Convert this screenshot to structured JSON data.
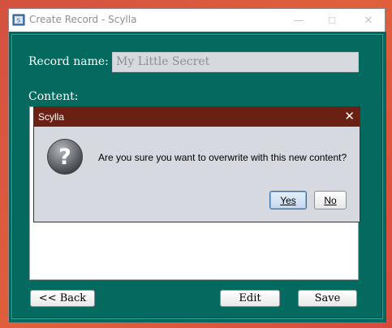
{
  "window": {
    "title": "Create Record - Scylla",
    "controls": {
      "minimize": "—",
      "maximize": "☐",
      "close": "✕"
    }
  },
  "form": {
    "record_name_label": "Record name:",
    "record_name_value": "My Little Secret",
    "content_label": "Content:",
    "content_value": ""
  },
  "buttons": {
    "back": "<< Back",
    "edit": "Edit",
    "save": "Save"
  },
  "dialog": {
    "title": "Scylla",
    "close": "✕",
    "icon": "question-icon",
    "message": "Are you sure you want to overwrite with this new content?",
    "yes": "Yes",
    "no": "No"
  },
  "colors": {
    "client_bg": "#04695f",
    "dialog_title_bg": "#6a2113",
    "dialog_bg": "#d6d9df"
  }
}
